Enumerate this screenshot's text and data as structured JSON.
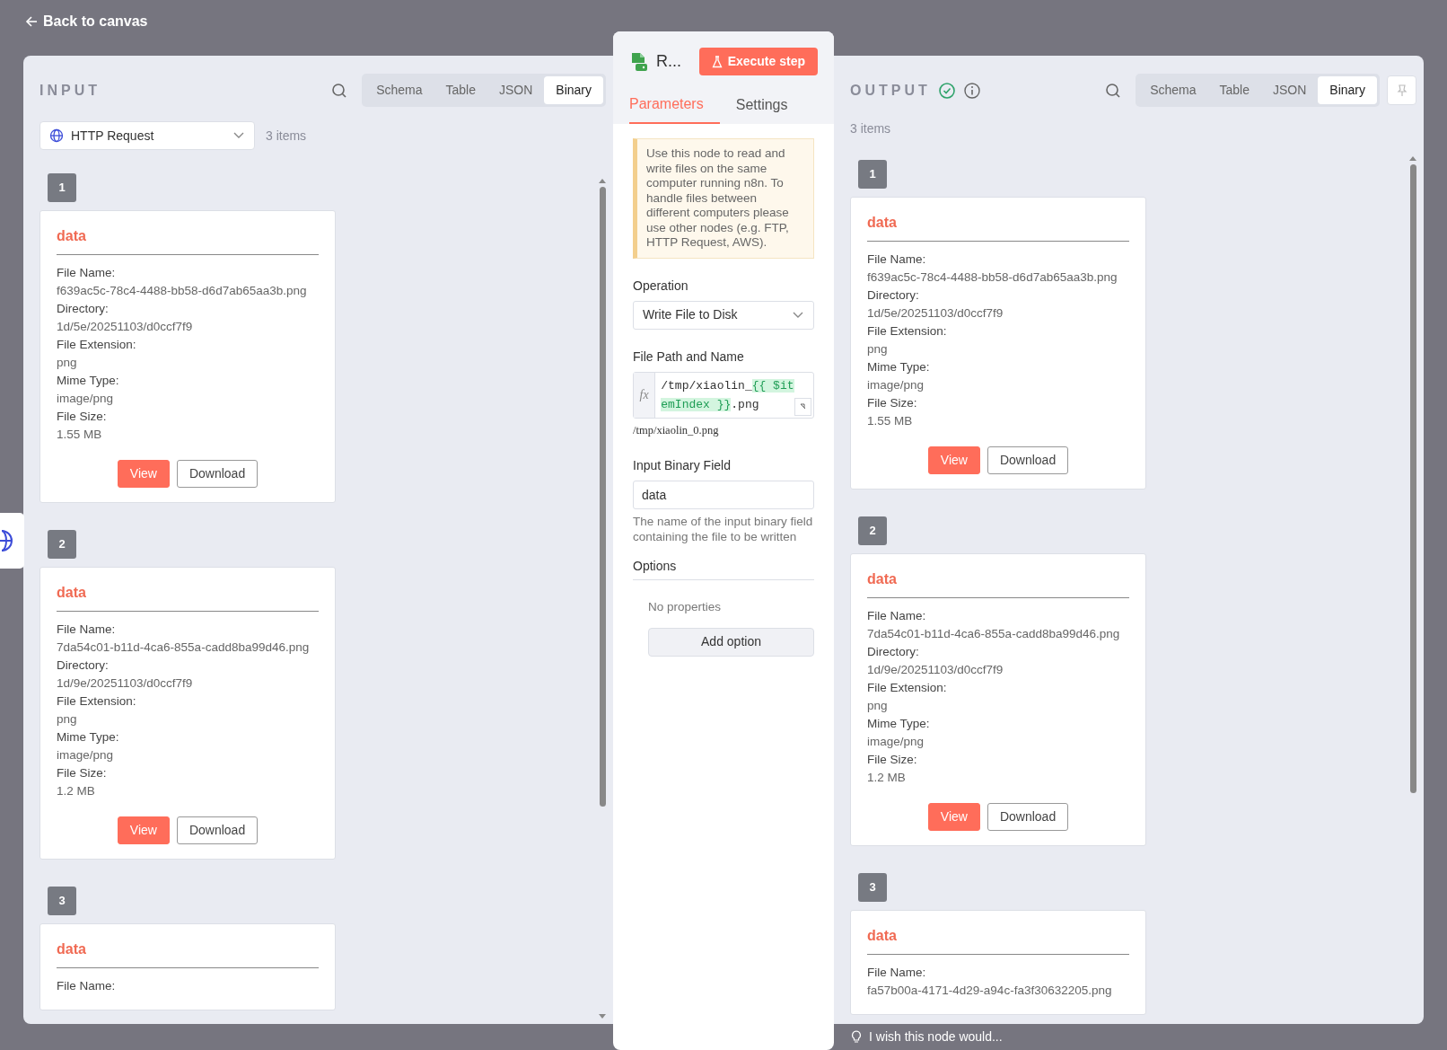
{
  "header": {
    "back_label": "Back to canvas"
  },
  "input": {
    "title": "INPUT",
    "source": "HTTP Request",
    "count": "3 items",
    "views": [
      {
        "label": "Schema",
        "selected": false
      },
      {
        "label": "Table",
        "selected": false
      },
      {
        "label": "JSON",
        "selected": false
      },
      {
        "label": "Binary",
        "selected": true
      }
    ],
    "items": [
      {
        "index": "1",
        "key": "data",
        "fields": [
          {
            "label": "File Name:",
            "value": "f639ac5c-78c4-4488-bb58-d6d7ab65aa3b.png"
          },
          {
            "label": "Directory:",
            "value": "1d/5e/20251103/d0ccf7f9"
          },
          {
            "label": "File Extension:",
            "value": "png"
          },
          {
            "label": "Mime Type:",
            "value": "image/png"
          },
          {
            "label": "File Size:",
            "value": "1.55 MB"
          }
        ],
        "buttons": [
          {
            "label": "View",
            "kind": "primary"
          },
          {
            "label": "Download",
            "kind": "outline"
          }
        ]
      },
      {
        "index": "2",
        "key": "data",
        "fields": [
          {
            "label": "File Name:",
            "value": "7da54c01-b11d-4ca6-855a-cadd8ba99d46.png"
          },
          {
            "label": "Directory:",
            "value": "1d/9e/20251103/d0ccf7f9"
          },
          {
            "label": "File Extension:",
            "value": "png"
          },
          {
            "label": "Mime Type:",
            "value": "image/png"
          },
          {
            "label": "File Size:",
            "value": "1.2 MB"
          }
        ],
        "buttons": [
          {
            "label": "View",
            "kind": "primary"
          },
          {
            "label": "Download",
            "kind": "outline"
          }
        ]
      },
      {
        "index": "3",
        "key": "data",
        "fields": [
          {
            "label": "File Name:"
          }
        ]
      }
    ]
  },
  "node": {
    "title": "R...",
    "execute_label": "Execute step",
    "tabs": [
      {
        "label": "Parameters",
        "selected": true
      },
      {
        "label": "Settings",
        "selected": false
      }
    ],
    "notice": "Use this node to read and write files on the same computer running n8n. To handle files between different computers please use other nodes (e.g. FTP, HTTP Request, AWS).",
    "parameters": [
      {
        "kind": "select",
        "label": "Operation",
        "value": "Write File to Disk"
      },
      {
        "kind": "expression",
        "label": "File Path and Name",
        "prefix": "fx",
        "parts": [
          {
            "kind": "plain",
            "text": "/tmp/xiaolin_"
          },
          {
            "kind": "expression",
            "text": "{{ $itemIndex }}"
          },
          {
            "kind": "plain",
            "text": ".png"
          }
        ],
        "preview": "/tmp/xiaolin_0.png"
      },
      {
        "kind": "text",
        "label": "Input Binary Field",
        "value": "data",
        "hint": "The name of the input binary field containing the file to be written"
      },
      {
        "kind": "collection",
        "label": "Options",
        "empty_text": "No properties",
        "button": "Add option"
      }
    ]
  },
  "output": {
    "title": "OUTPUT",
    "succeeded": true,
    "count": "3 items",
    "views": [
      {
        "label": "Schema",
        "selected": false
      },
      {
        "label": "Table",
        "selected": false
      },
      {
        "label": "JSON",
        "selected": false
      },
      {
        "label": "Binary",
        "selected": true
      }
    ],
    "items": [
      {
        "index": "1",
        "key": "data",
        "fields": [
          {
            "label": "File Name:",
            "value": "f639ac5c-78c4-4488-bb58-d6d7ab65aa3b.png"
          },
          {
            "label": "Directory:",
            "value": "1d/5e/20251103/d0ccf7f9"
          },
          {
            "label": "File Extension:",
            "value": "png"
          },
          {
            "label": "Mime Type:",
            "value": "image/png"
          },
          {
            "label": "File Size:",
            "value": "1.55 MB"
          }
        ],
        "buttons": [
          {
            "label": "View",
            "kind": "primary"
          },
          {
            "label": "Download",
            "kind": "outline"
          }
        ]
      },
      {
        "index": "2",
        "key": "data",
        "fields": [
          {
            "label": "File Name:",
            "value": "7da54c01-b11d-4ca6-855a-cadd8ba99d46.png"
          },
          {
            "label": "Directory:",
            "value": "1d/9e/20251103/d0ccf7f9"
          },
          {
            "label": "File Extension:",
            "value": "png"
          },
          {
            "label": "Mime Type:",
            "value": "image/png"
          },
          {
            "label": "File Size:",
            "value": "1.2 MB"
          }
        ],
        "buttons": [
          {
            "label": "View",
            "kind": "primary"
          },
          {
            "label": "Download",
            "kind": "outline"
          }
        ]
      },
      {
        "index": "3",
        "key": "data",
        "fields": [
          {
            "label": "File Name:",
            "value": "fa57b00a-4171-4d29-a94c-fa3f30632205.png"
          }
        ]
      }
    ]
  },
  "footer": {
    "feedback": "I wish this node would..."
  }
}
